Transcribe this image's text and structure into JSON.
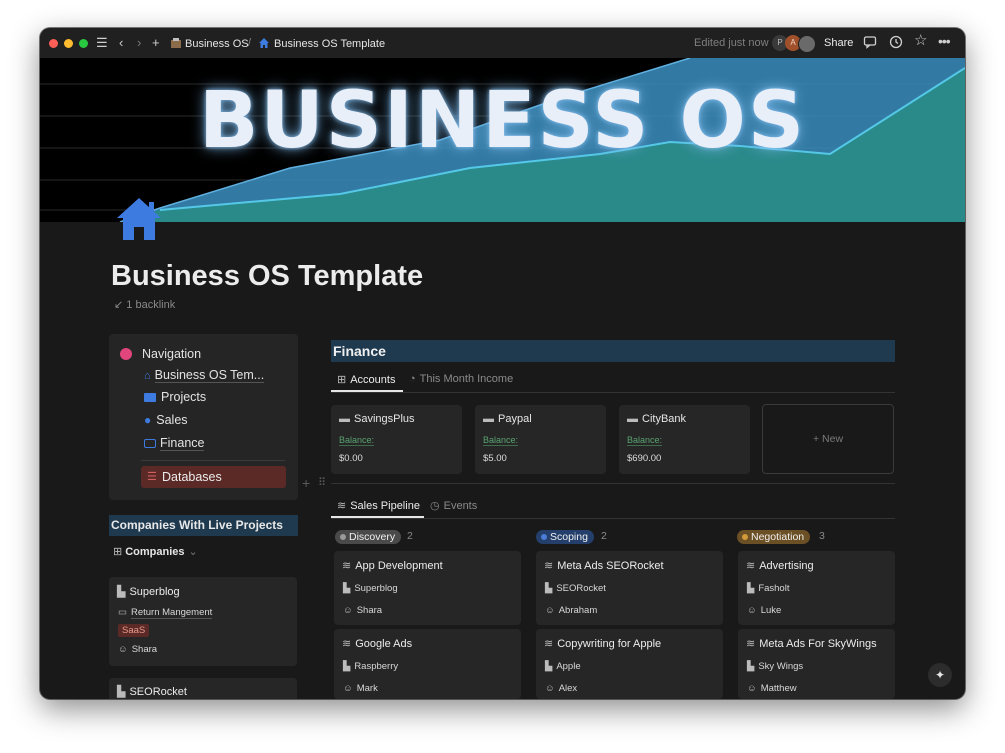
{
  "topbar": {
    "breadcrumb_root": "Business OS",
    "breadcrumb_sep": "/",
    "breadcrumb_page": "Business OS Template",
    "edited": "Edited just now",
    "avatar_p": "P",
    "avatar_a": "A",
    "share": "Share"
  },
  "cover": {
    "title": "BUSINESS OS"
  },
  "page": {
    "title": "Business OS Template",
    "backlink": "1 backlink"
  },
  "navigation": {
    "heading": "Navigation",
    "items": [
      "Business OS Tem...",
      "Projects",
      "Sales",
      "Finance"
    ],
    "databases": "Databases"
  },
  "companies": {
    "header": "Companies With Live Projects",
    "view": "Companies",
    "cards": [
      {
        "name": "Superblog",
        "project": "Return Mangement",
        "tag": "SaaS",
        "owner": "Shara"
      },
      {
        "name": "SEORocket"
      }
    ]
  },
  "finance": {
    "header": "Finance",
    "tabs": [
      "Accounts",
      "This Month Income"
    ],
    "balance_label": "Balance:",
    "accounts": [
      {
        "name": "SavingsPlus",
        "balance": "$0.00"
      },
      {
        "name": "Paypal",
        "balance": "$5.00"
      },
      {
        "name": "CityBank",
        "balance": "$690.00"
      }
    ],
    "new_label": "+ New"
  },
  "sales": {
    "tabs": [
      "Sales Pipeline",
      "Events"
    ],
    "columns": [
      {
        "status": "Discovery",
        "count": "2",
        "color": "#7d7d7d",
        "bg": "#4a4a4a",
        "cards": [
          {
            "title": "App Development",
            "company": "Superblog",
            "person": "Shara"
          },
          {
            "title": "Google Ads",
            "company": "Raspberry",
            "person": "Mark"
          }
        ]
      },
      {
        "status": "Scoping",
        "count": "2",
        "color": "#4a7dd6",
        "bg": "#243f6b",
        "cards": [
          {
            "title": "Meta Ads SEORocket",
            "company": "SEORocket",
            "person": "Abraham"
          },
          {
            "title": "Copywriting for Apple",
            "company": "Apple",
            "person": "Alex"
          }
        ]
      },
      {
        "status": "Negotiation",
        "count": "3",
        "color": "#d39a3a",
        "bg": "#6b4f25",
        "cards": [
          {
            "title": "Advertising",
            "company": "Fasholt",
            "person": "Luke"
          },
          {
            "title": "Meta Ads For SkyWings",
            "company": "Sky Wings",
            "person": "Matthew"
          }
        ]
      }
    ]
  },
  "colors": {
    "accent_header": "#1f3a4f",
    "databases_bg": "#5b2a27",
    "chart_blue": "#3b8fc0",
    "chart_teal": "#2a8a8a"
  }
}
